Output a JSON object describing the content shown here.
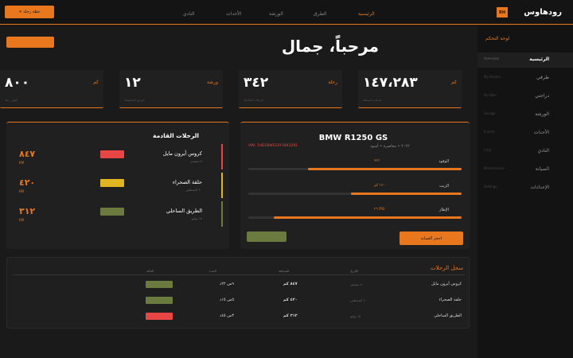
{
  "header": {
    "brand": "رودهاوس",
    "logo_initials": "RH",
    "new_trip_button": "+ خطة رحلة",
    "nav": [
      "الرئيسية",
      "الطرق",
      "الورشة",
      "الأحداث",
      "النادي"
    ]
  },
  "sidebar": {
    "title": "لوحة التحكم",
    "items": [
      {
        "en": "Overview",
        "ar": "الرئيسية",
        "active": true
      },
      {
        "en": "My Routes",
        "ar": "طرقي"
      },
      {
        "en": "My Bike",
        "ar": "دراجتي"
      },
      {
        "en": "Garage",
        "ar": "الورشة"
      },
      {
        "en": "Events",
        "ar": "الأحداث"
      },
      {
        "en": "Club",
        "ar": "النادي"
      },
      {
        "en": "Maintenance",
        "ar": "الصيانة"
      },
      {
        "en": "Settings",
        "ar": "الإعدادات"
      }
    ]
  },
  "welcome": "مرحباً، جمال",
  "stats": [
    {
      "value": "١٤٧،٢٨٣",
      "unit": "كم",
      "label": "إجمالي المسافة",
      "sub": "Total KM"
    },
    {
      "value": "٣٤٢",
      "unit": "رحلة",
      "label": "الرحلات المكتملة",
      "sub": "Rides Completed"
    },
    {
      "value": "١٢",
      "unit": "ورشة",
      "label": "الورش المحفوظة",
      "sub": "Saved Garages"
    },
    {
      "value": "٨٠٠",
      "unit": "كم",
      "label": "أطول رحلة",
      "sub": "Longest Ride"
    }
  ],
  "upcoming": {
    "title": "الرحلات القادمة",
    "trips": [
      {
        "name": "كروس أيرون مايل",
        "date": "٨ سبتمبر",
        "dist": "٨٤٧",
        "km": "KM",
        "color": "#e84545"
      },
      {
        "name": "حلقة الصحراء",
        "date": "٢٠ أغسطس",
        "dist": "٤٢٠",
        "km": "KM",
        "color": "#e0b521"
      },
      {
        "name": "الطريق الساحلي",
        "date": "١٥ يوليو",
        "dist": "٣١٢",
        "km": "KM",
        "color": "#6b7a3e"
      }
    ]
  },
  "bike": {
    "model": "BMW R1250 GS",
    "meta": "٢٠٢٢ • معاصرة • أسود",
    "vin": "VIN: 1HD1BWS16Y1843291",
    "gauges": [
      {
        "label": "الوقود",
        "value": "٧٢٪",
        "fill": 0.72
      },
      {
        "label": "الزيت",
        "value": "١٢٠٠ كم",
        "fill": 0.52
      },
      {
        "label": "الإطار",
        "value": "٣٦ PSI",
        "fill": 0.88
      }
    ],
    "book_service": "احجز الصيانة",
    "secondary": ""
  },
  "log": {
    "title": "سجل الرحلات",
    "headers": [
      "التاريخ",
      "المسافة",
      "المدة",
      "الحالة"
    ],
    "rows": [
      {
        "name": "كروس أيرون مايل",
        "date": "٨ سبتمبر",
        "dist": "٨٤٧ كم",
        "dur": "٩س ٢٢د",
        "color": "#6b7a3e"
      },
      {
        "name": "حلقة الصحراء",
        "date": "٢٠ أغسطس",
        "dist": "٤٢٠ كم",
        "dur": "٥س ١٥د",
        "color": "#6b7a3e"
      },
      {
        "name": "الطريق الساحلي",
        "date": "١٥ يوليو",
        "dist": "٣١٢ كم",
        "dur": "٣س ٤٥د",
        "color": "#e84545"
      }
    ]
  }
}
